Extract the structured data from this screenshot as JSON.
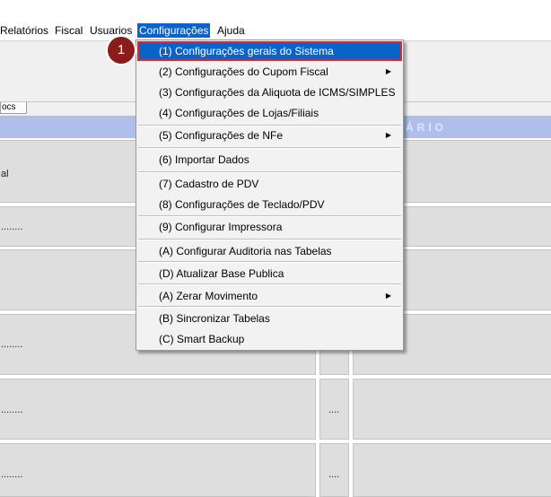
{
  "menubar": {
    "items": [
      {
        "label": "Relatórios"
      },
      {
        "label": "Fiscal"
      },
      {
        "label": "Usuarios"
      },
      {
        "label": "Configurações"
      },
      {
        "label": "Ajuda"
      }
    ]
  },
  "toolbar": {
    "tab_label": "ocs"
  },
  "header": {
    "text": "ÁRIO"
  },
  "grid": {
    "row1_label": "al",
    "dots": "........"
  },
  "dropdown": {
    "items": [
      {
        "label": "(1) Configurações gerais do Sistema"
      },
      {
        "label": "(2) Configurações do Cupom Fiscal"
      },
      {
        "label": "(3) Configurações da Aliquota de ICMS/SIMPLES"
      },
      {
        "label": "(4) Configurações de Lojas/Filiais"
      },
      {
        "label": "(5) Configurações de NFe"
      },
      {
        "label": "(6) Importar Dados"
      },
      {
        "label": "(7) Cadastro de PDV"
      },
      {
        "label": "(8) Configurações de Teclado/PDV"
      },
      {
        "label": "(9) Configurar Impressora"
      },
      {
        "label": "(A) Configurar Auditoria nas Tabelas"
      },
      {
        "label": "(D) Atualizar Base Publica"
      },
      {
        "label": "(A) Zerar Movimento"
      },
      {
        "label": "(B) Sincronizar Tabelas"
      },
      {
        "label": "(C) Smart Backup"
      }
    ]
  },
  "step_badge": "1",
  "colors": {
    "highlight": "#0a64c8",
    "highlight_border": "#d9273a",
    "badge": "#8a1c1c",
    "header": "#afbfea"
  }
}
